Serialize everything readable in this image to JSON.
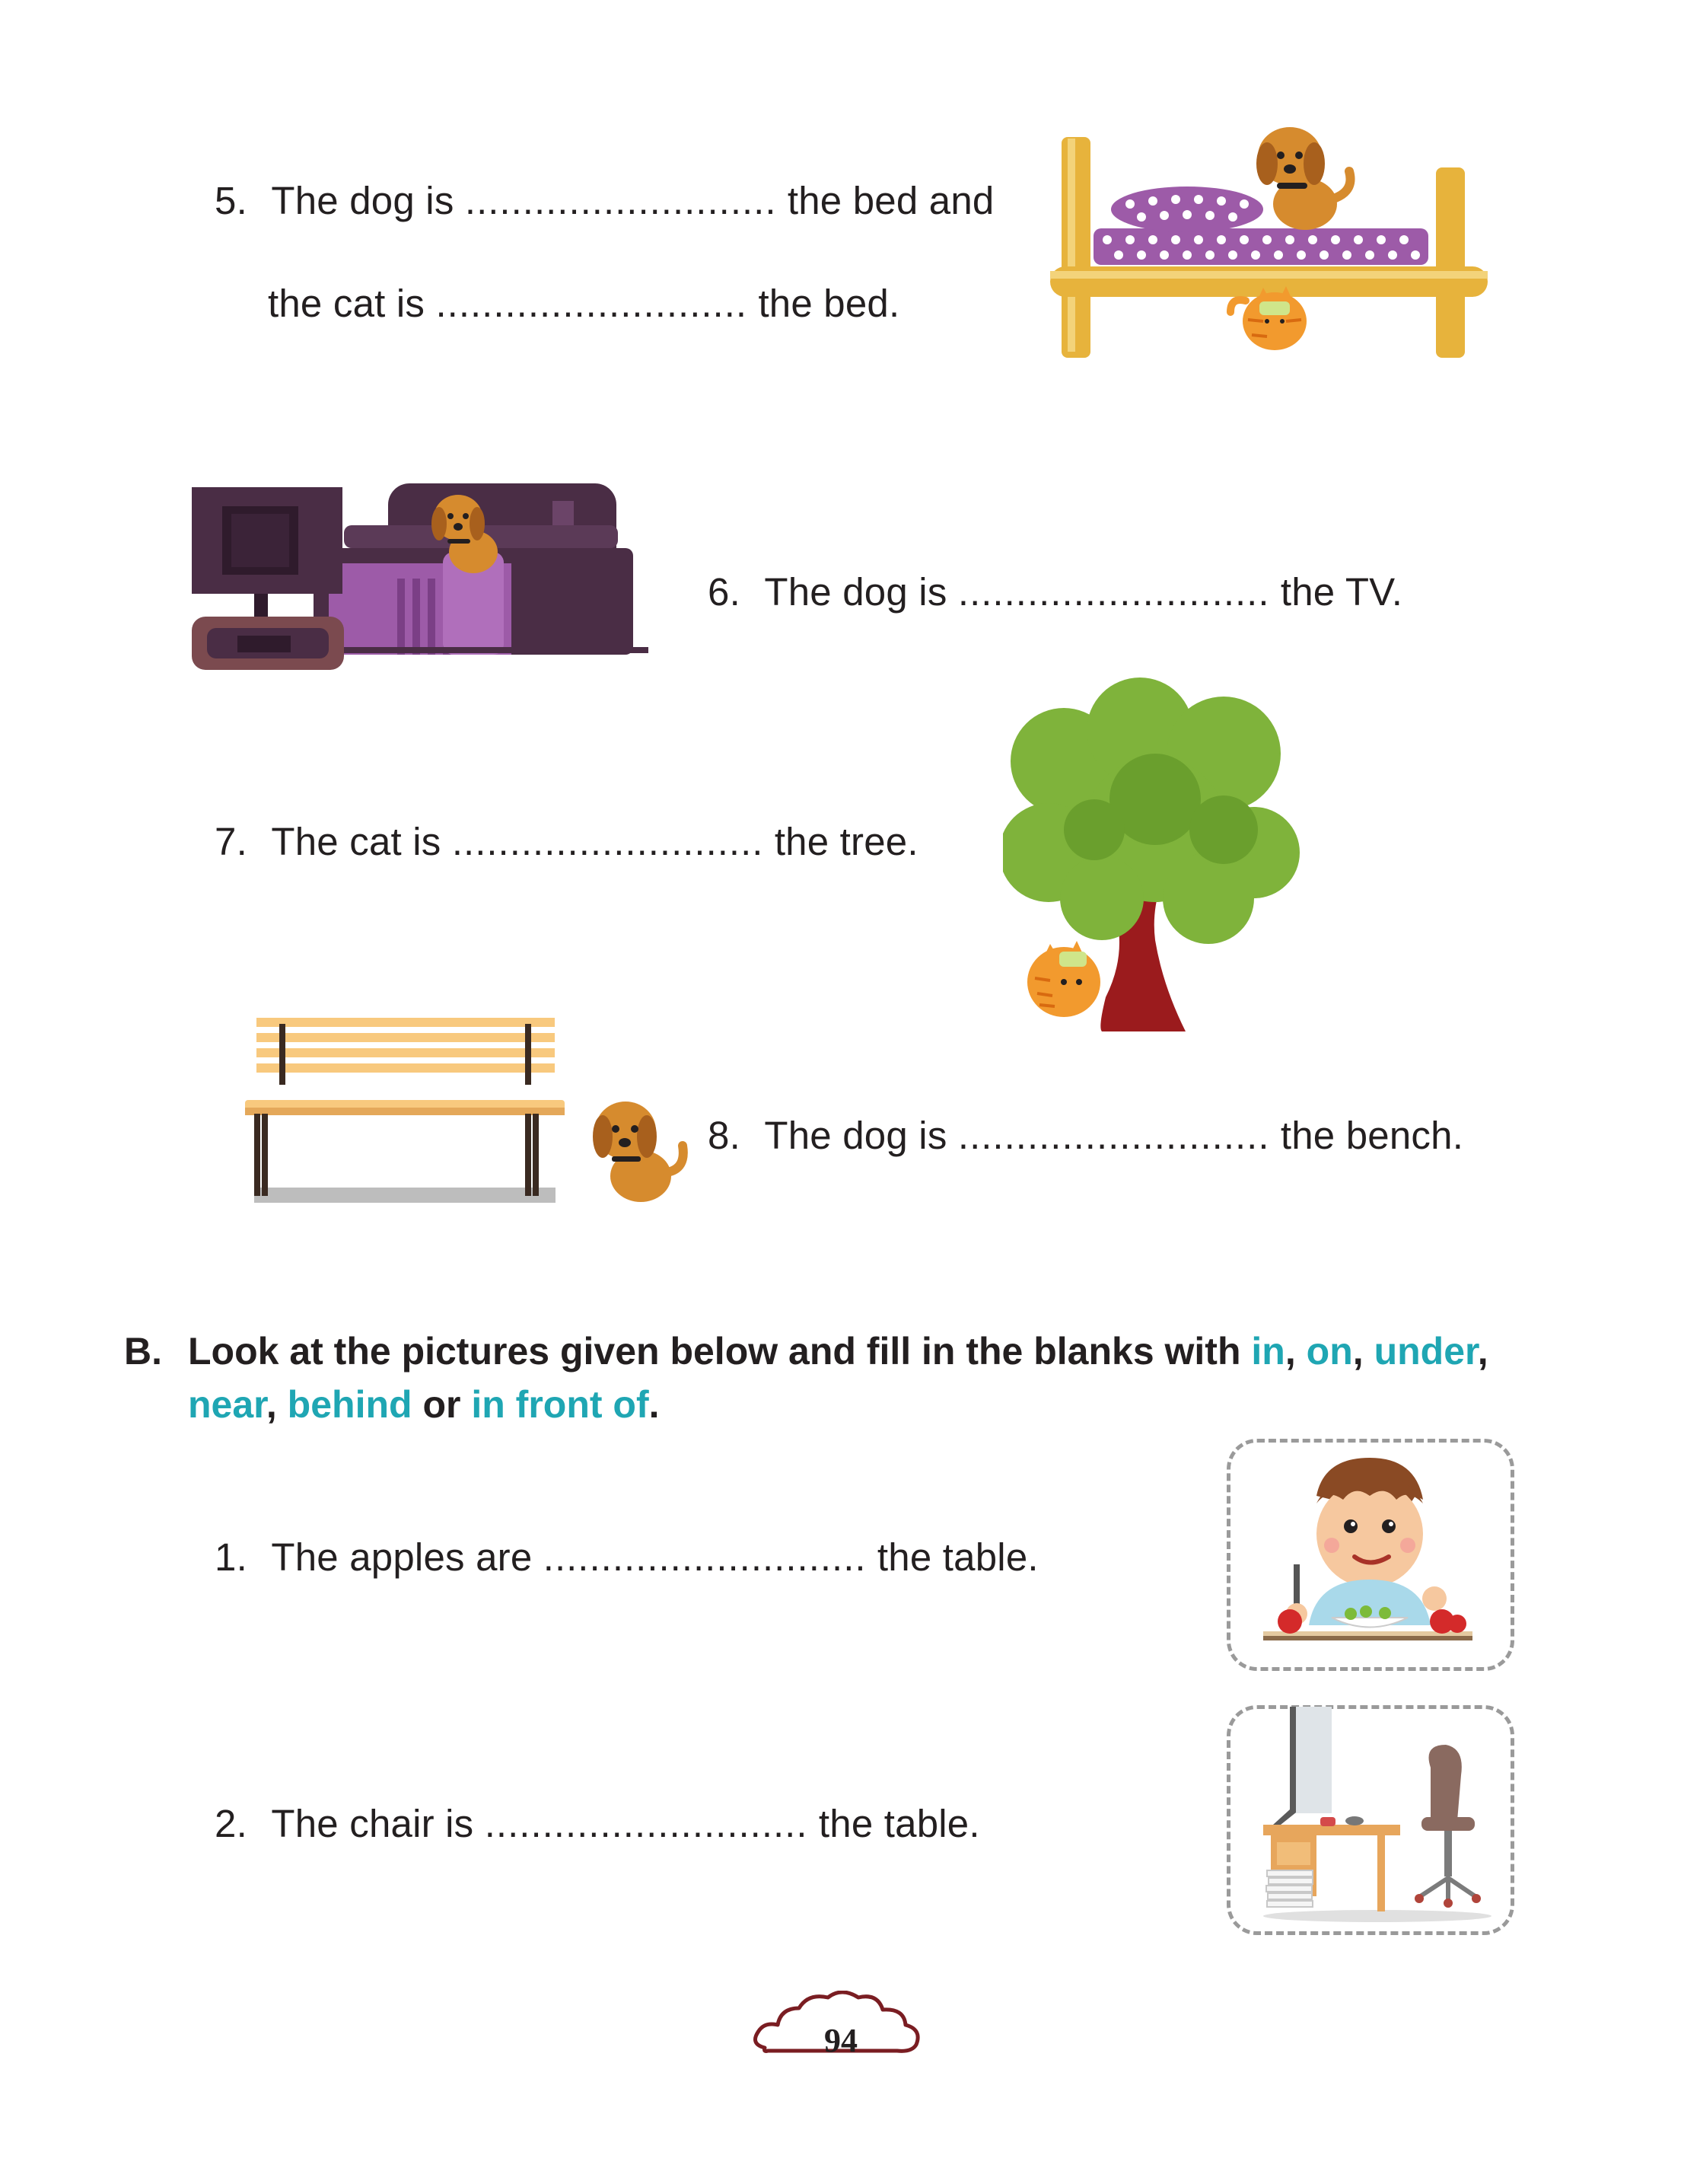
{
  "questions_a": [
    {
      "num": "5.",
      "prefix": "The dog is",
      "blank": "...........................",
      "suffix": "the bed and"
    },
    {
      "num": "",
      "prefix": "the cat is",
      "blank": "...........................",
      "suffix": "the bed."
    },
    {
      "num": "6.",
      "prefix": "The dog is",
      "blank": "...........................",
      "suffix": "the TV."
    },
    {
      "num": "7.",
      "prefix": "The cat is",
      "blank": "...........................",
      "suffix": "the tree."
    },
    {
      "num": "8.",
      "prefix": "The dog is",
      "blank": "...........................",
      "suffix": "the bench."
    }
  ],
  "section_b": {
    "label": "B.",
    "instruction_start": "Look at the pictures given below and fill in the blanks with",
    "kw1": "in",
    "sep1": ",",
    "kw2": "on",
    "sep2": ",",
    "kw3": "under",
    "sep3": ",",
    "kw4": "near",
    "sep4": ",",
    "kw5": "behind",
    "or": "or",
    "kw6": "in front of",
    "end": ".",
    "keyword_color": "#1fa6b3",
    "questions": [
      {
        "num": "1.",
        "prefix": "The apples are",
        "blank": "............................",
        "suffix": "the table."
      },
      {
        "num": "2.",
        "prefix": "The chair is",
        "blank": "............................",
        "suffix": "the table."
      }
    ]
  },
  "page_number": "94",
  "images": [
    "dog-on-bed-cat-under-bed",
    "dog-on-sofa-behind-tv",
    "cat-behind-tree",
    "dog-near-bench",
    "boy-eating-at-table",
    "desk-and-chair"
  ]
}
